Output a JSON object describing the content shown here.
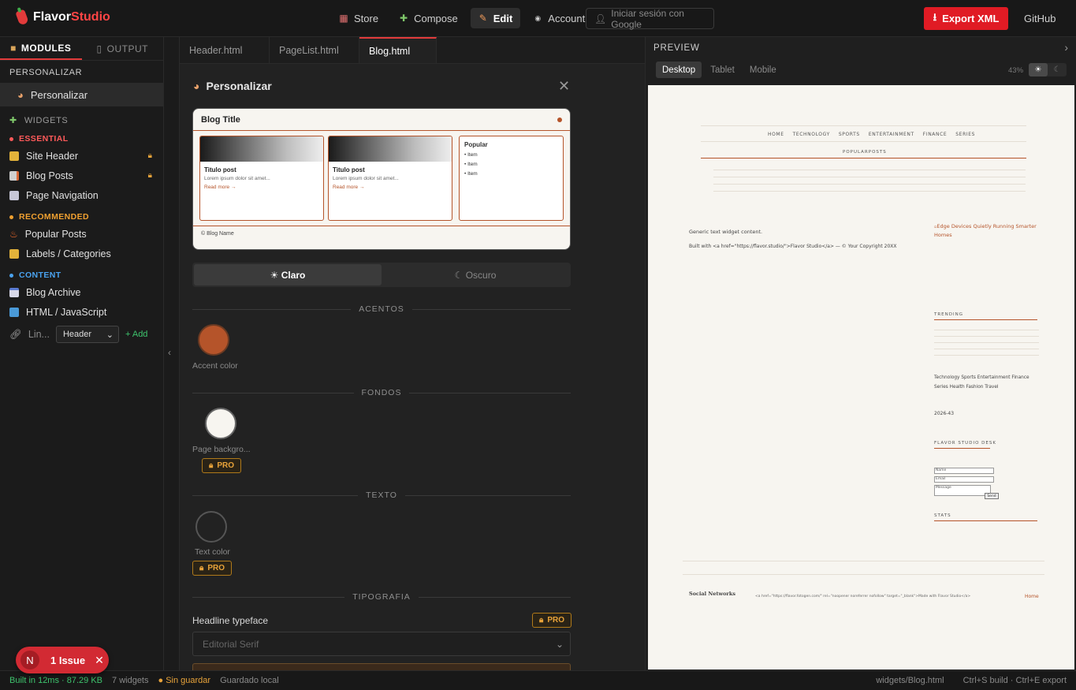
{
  "app": {
    "brand_a": "Flavor",
    "brand_b": "Studio"
  },
  "nav": {
    "store": "Store",
    "compose": "Compose",
    "edit": "Edit",
    "account": "Account",
    "google": "Iniciar sesión con Google",
    "export": "Export XML",
    "github": "GitHub"
  },
  "sidebar": {
    "tabs": [
      "MODULES",
      "OUTPUT"
    ],
    "personalizar_heading": "PERSONALIZAR",
    "personalizar_item": "Personalizar",
    "widgets_heading": "WIDGETS",
    "essential": "ESSENTIAL",
    "recommended": "RECOMMENDED",
    "content": "CONTENT",
    "items": {
      "site_header": "Site Header",
      "blog_posts": "Blog Posts",
      "page_navigation": "Page Navigation",
      "popular_posts": "Popular Posts",
      "labels": "Labels / Categories",
      "blog_archive": "Blog Archive",
      "html_js": "HTML / JavaScript"
    },
    "lin_label": "Lin...",
    "lin_select": "Header",
    "lin_add": "+ Add"
  },
  "editor": {
    "tabs": [
      "Header.html",
      "PageList.html",
      "Blog.html"
    ],
    "panel_title": "Personalizar",
    "preview": {
      "title": "Blog Title",
      "post_title": "Titulo post",
      "post_lorem": "Lorem ipsum dolor sit amet...",
      "read_more": "Read more →",
      "popular": "Popular",
      "item": "• Item",
      "footer": "© Blog Name"
    },
    "theme": {
      "light": "☀ Claro",
      "dark": "☾ Oscuro"
    },
    "sections": {
      "acentos": "ACENTOS",
      "fondos": "FONDOS",
      "texto": "TEXTO",
      "tipografia": "TIPOGRAFIA"
    },
    "accent_label": "Accent color",
    "bg_label": "Page backgro...",
    "text_label": "Text color",
    "pro": "PRO",
    "headline_label": "Headline typeface",
    "headline_value": "Editorial Serif",
    "colors": {
      "accent": "#b5542a",
      "background": "#f7f5f0",
      "text": "#2a2a2a"
    }
  },
  "preview": {
    "title": "PREVIEW",
    "devices": [
      "Desktop",
      "Tablet",
      "Mobile"
    ],
    "zoom": "43%",
    "blog": {
      "nav": [
        "HOME",
        "TECHNOLOGY",
        "SPORTS",
        "ENTERTAINMENT",
        "FINANCE",
        "SERIES"
      ],
      "popular": "POPULARPOSTS",
      "generic": "Generic text widget content.",
      "built_with": "Built with <a href=\"https://flavor.studio/\">Flavor Studio</a> — © Your Copyright 20XX",
      "img_alt": "Edge Devices Quietly Running Smarter Homes",
      "trending": "TRENDING",
      "labels_line1": "Technology Sports Entertainment Finance",
      "labels_line2": "Series Health Fashion Travel",
      "archive": "2026-43",
      "desk": "FLAVOR STUDIO DESK",
      "name": "Name",
      "email": "Email",
      "message": "Message",
      "send": "Send",
      "stats": "STATS",
      "social": "Social Networks",
      "footer_code": "<a href=\"https://flavor.fotogen.com/\" rel=\"noopener noreferrer nofollow\" target=\"_blank\">Made with Flavor Studio</a>",
      "home": "Home"
    }
  },
  "status": {
    "built": "Built in 12ms · 87.29 KB",
    "widgets": "7 widgets",
    "unsaved": "● Sin guardar",
    "saved_local": "Guardado local",
    "file": "widgets/Blog.html",
    "shortcuts": "Ctrl+S build · Ctrl+E export"
  },
  "issue": {
    "badge": "N",
    "text": "1 Issue"
  }
}
